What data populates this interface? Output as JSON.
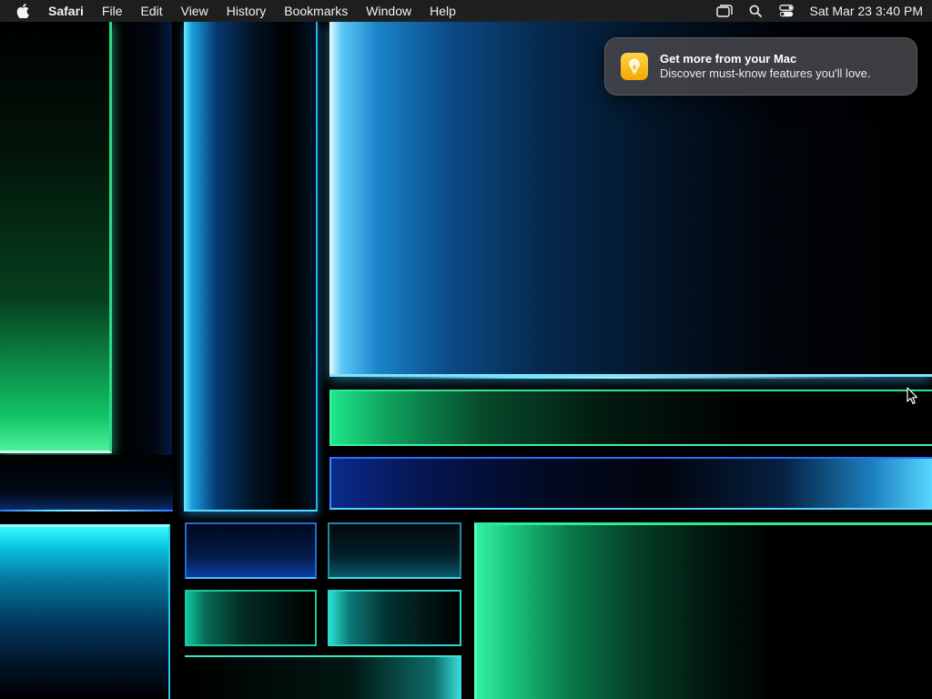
{
  "menubar": {
    "apple_icon": "apple-logo-icon",
    "app_name": "Safari",
    "menus": [
      "File",
      "Edit",
      "View",
      "History",
      "Bookmarks",
      "Window",
      "Help"
    ],
    "status_icons": [
      "screen-mirroring-icon",
      "spotlight-search-icon",
      "control-center-icon"
    ],
    "clock": "Sat Mar 23  3:40 PM"
  },
  "notification": {
    "icon": "tips-lightbulb-icon",
    "title": "Get more from your Mac",
    "body": "Discover must-know features you'll love."
  },
  "wallpaper": {
    "accent_colors": [
      "#1ee68a",
      "#5cc8f7",
      "#39fbff",
      "#2a6cff"
    ]
  },
  "cursor": {
    "icon": "arrow-pointer-icon"
  }
}
